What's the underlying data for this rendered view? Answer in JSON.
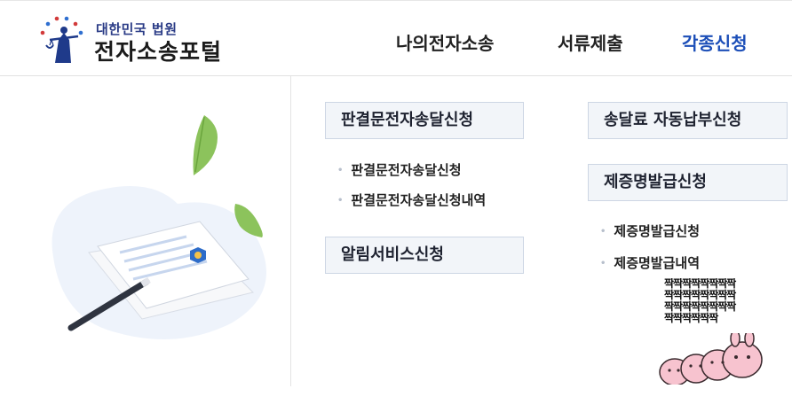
{
  "header": {
    "logo_subtitle": "대한민국 법원",
    "logo_title": "전자소송포털",
    "nav": [
      {
        "label": "나의전자소송"
      },
      {
        "label": "서류제출"
      },
      {
        "label": "각종신청"
      }
    ]
  },
  "menu": {
    "left_col": {
      "section1": {
        "title": "판결문전자송달신청",
        "items": [
          "판결문전자송달신청",
          "판결문전자송달신청내역"
        ]
      },
      "section2": {
        "title": "알림서비스신청"
      }
    },
    "right_col": {
      "section1": {
        "title": "송달료 자동납부신청"
      },
      "section2": {
        "title": "제증명발급신청",
        "items": [
          "제증명발급신청",
          "제증명발급내역"
        ]
      }
    }
  },
  "sticker": {
    "text": "짝짝짝짝짝짝짝짝\n짝짝짝짝짝짝짝짝\n짝짝짝짝짝짝짝짝\n짝짝짝짝짝짝"
  },
  "colors": {
    "nav_active": "#1d4fb8",
    "menu_box_bg": "#f2f5f9",
    "menu_box_border": "#cdd6e4",
    "logo_blue": "#2a3b86"
  },
  "icons": [
    "court-emblem-icon",
    "leaf-icon",
    "document-icon",
    "pen-icon"
  ]
}
